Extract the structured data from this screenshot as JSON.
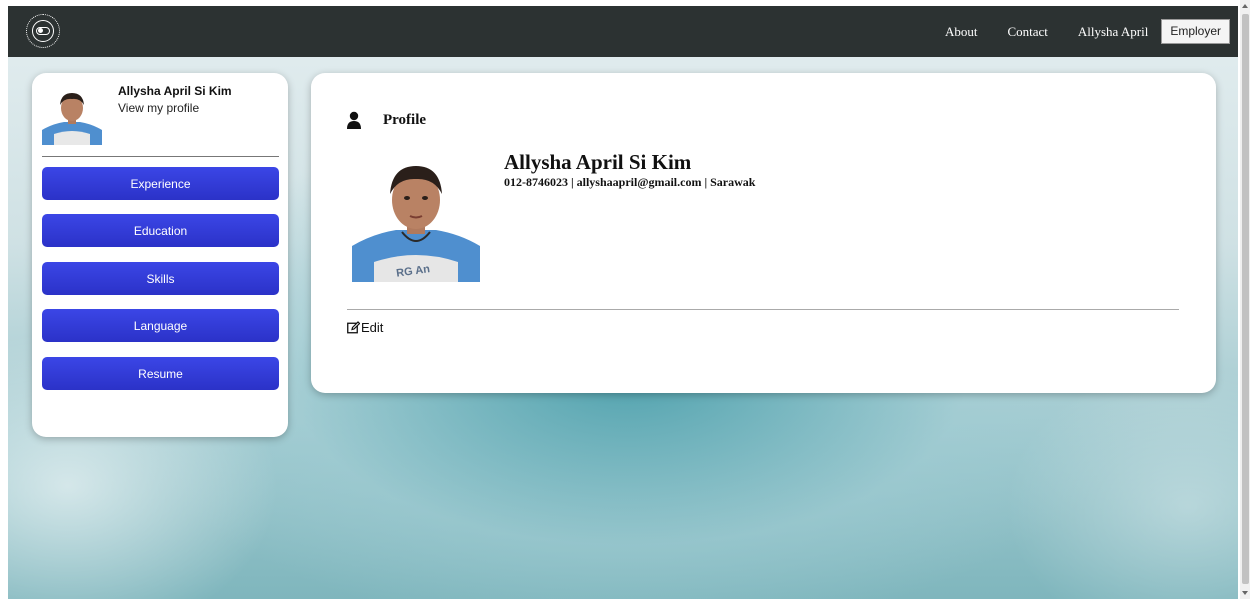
{
  "navbar": {
    "logo_icon": "toggle-logo-icon",
    "links": [
      "About",
      "Contact",
      "Allysha April"
    ],
    "employer_button": "Employer"
  },
  "sidebar": {
    "name": "Allysha April Si Kim",
    "subtitle": "View my profile",
    "buttons": [
      "Experience",
      "Education",
      "Skills",
      "Language",
      "Resume"
    ],
    "button_color": "#2f3bd8"
  },
  "profile": {
    "title": "Profile",
    "name": "Allysha April Si Kim",
    "contact": "012-8746023 | allyshaapril@gmail.com | Sarawak",
    "edit_label": "Edit",
    "edit_icon": "edit-icon",
    "title_icon": "person-icon"
  },
  "colors": {
    "navbar": "#2c3232",
    "card": "#ffffff",
    "background": "#7fb6bd"
  }
}
